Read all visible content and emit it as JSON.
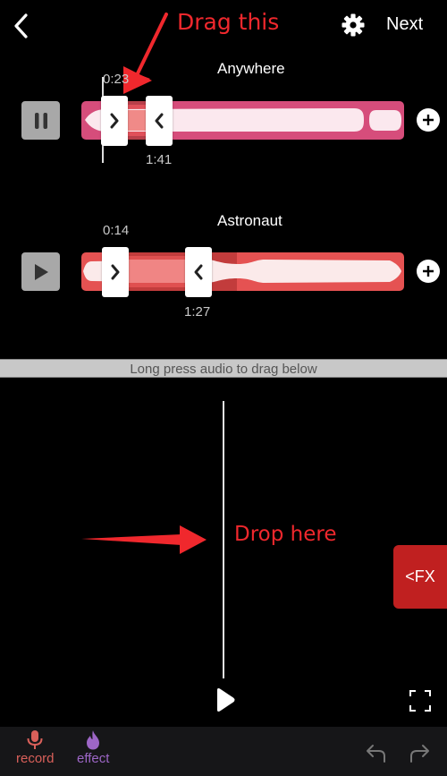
{
  "header": {
    "back_icon": "chevron-left-icon",
    "settings_icon": "gear-icon",
    "next_label": "Next"
  },
  "annotations": {
    "drag_label": "Drag this",
    "drop_label": "Drop here",
    "color": "#f0282d"
  },
  "tracks": [
    {
      "title": "Anywhere",
      "state": "playing",
      "control_icon": "pause-icon",
      "start_time": "0:23",
      "end_time": "1:41",
      "color": "#d64d7b",
      "selection_color": "#e0505a",
      "add_icon": "plus-circle-icon"
    },
    {
      "title": "Astronaut",
      "state": "paused",
      "control_icon": "play-icon",
      "start_time": "0:14",
      "end_time": "1:27",
      "color": "#e55252",
      "selection_color": "#e05050",
      "add_icon": "plus-circle-icon"
    }
  ],
  "hint": "Long press audio to drag below",
  "timeline": {
    "play_icon": "play-icon",
    "fullscreen_icon": "fullscreen-icon",
    "fx_label": "<FX",
    "fx_color": "#c02020"
  },
  "bottom_bar": {
    "tabs": [
      {
        "label": "record",
        "icon": "microphone-icon",
        "color": "#d9605a"
      },
      {
        "label": "effect",
        "icon": "flame-icon",
        "color": "#9d66c6"
      }
    ],
    "undo_icon": "undo-icon",
    "redo_icon": "redo-icon"
  }
}
